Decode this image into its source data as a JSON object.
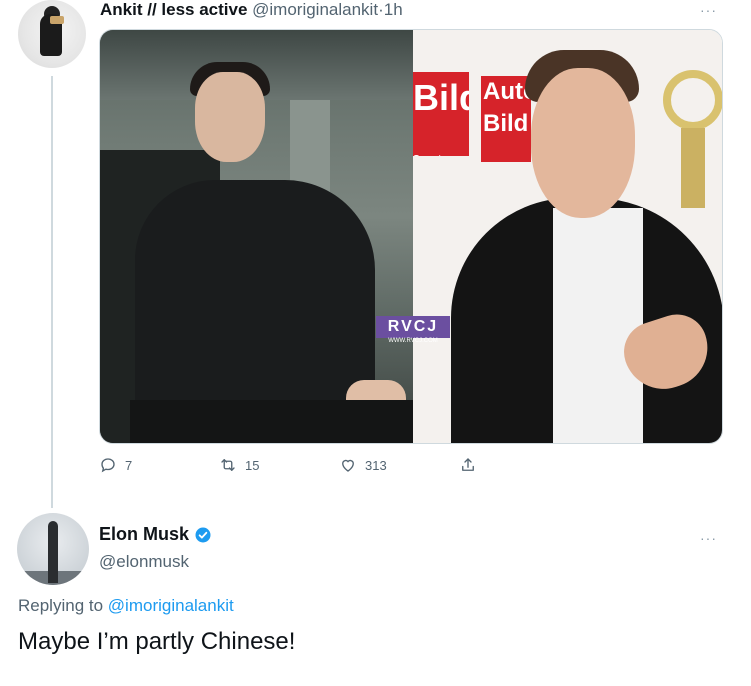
{
  "top_tweet": {
    "author_name": "Ankit // less active",
    "handle": "@imoriginalankit",
    "separator": "·",
    "time": "1h",
    "more": "···",
    "media": {
      "left_watermark": "RVCJ",
      "left_watermark_sub": "WWW.RVCJ.COM",
      "right_sign_1": "Bild",
      "right_sign_1_sub": "Sonntag",
      "right_sign_2": "Auto Bild"
    },
    "actions": {
      "reply_count": "7",
      "retweet_count": "15",
      "like_count": "313",
      "share_label": ""
    }
  },
  "reply_tweet": {
    "author_name": "Elon Musk",
    "handle": "@elonmusk",
    "more": "···",
    "replying_prefix": "Replying to",
    "replying_to": "@imoriginalankit",
    "text": "Maybe I’m partly Chinese!"
  },
  "colors": {
    "link": "#1d9bf0",
    "secondary_text": "#536471",
    "verified": "#1d9bf0",
    "thread_line": "#cfd9de"
  }
}
